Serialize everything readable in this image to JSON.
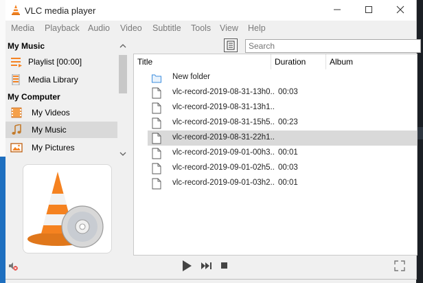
{
  "window": {
    "title": "VLC media player"
  },
  "menu": [
    "Media",
    "Playback",
    "Audio",
    "Video",
    "Subtitle",
    "Tools",
    "View",
    "Help"
  ],
  "sidebar": {
    "section1": "My Music",
    "items1": [
      {
        "label": "Playlist [00:00]",
        "icon": "playlist-icon"
      },
      {
        "label": "Media Library",
        "icon": "media-library-icon"
      }
    ],
    "section2": "My Computer",
    "items2": [
      {
        "label": "My Videos",
        "icon": "film-icon"
      },
      {
        "label": "My Music",
        "icon": "music-note-icon",
        "selected": true
      },
      {
        "label": "My Pictures",
        "icon": "picture-icon"
      }
    ]
  },
  "search": {
    "placeholder": "Search"
  },
  "list": {
    "columns": [
      "Title",
      "Duration",
      "Album"
    ],
    "rows": [
      {
        "title": "New folder",
        "duration": "",
        "type": "folder"
      },
      {
        "title": "vlc-record-2019-08-31-13h0...",
        "duration": "00:03",
        "type": "file"
      },
      {
        "title": "vlc-record-2019-08-31-13h1...",
        "duration": "",
        "type": "file"
      },
      {
        "title": "vlc-record-2019-08-31-15h5...",
        "duration": "00:23",
        "type": "file"
      },
      {
        "title": "vlc-record-2019-08-31-22h1...",
        "duration": "",
        "type": "file",
        "selected": true
      },
      {
        "title": "vlc-record-2019-09-01-00h3...",
        "duration": "00:01",
        "type": "file"
      },
      {
        "title": "vlc-record-2019-09-01-02h5...",
        "duration": "00:03",
        "type": "file"
      },
      {
        "title": "vlc-record-2019-09-01-03h2...",
        "duration": "00:01",
        "type": "file"
      }
    ]
  },
  "colors": {
    "vlc_orange": "#f58220",
    "selection": "#d9d9d9",
    "folder_blue": "#3c8dde"
  }
}
